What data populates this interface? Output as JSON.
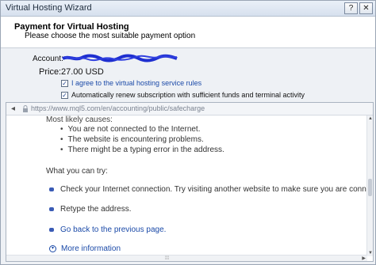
{
  "window": {
    "title": "Virtual Hosting Wizard",
    "help_label": "?",
    "close_label": "✕"
  },
  "header": {
    "title": "Payment for Virtual Hosting",
    "subtitle": "Please choose the most suitable payment option"
  },
  "form": {
    "account_label": "Account:",
    "price_label": "Price:",
    "price_value": "27.00 USD",
    "agree_label": "I agree to the virtual hosting service rules",
    "agree_checked": true,
    "renew_label": "Automatically renew subscription with sufficient funds and terminal activity",
    "renew_checked": true
  },
  "browser": {
    "url": "https://www.mql5.com/en/accounting/public/safecharge",
    "likely_causes_title": "Most likely causes:",
    "causes": [
      "You are not connected to the Internet.",
      "The website is encountering problems.",
      "There might be a typing error in the address."
    ],
    "try_title": "What you can try:",
    "try_items": [
      "Check your Internet connection. Try visiting another website to make sure you are connect",
      "Retype the address.",
      "Go back to the previous page.",
      "More information"
    ]
  },
  "colors": {
    "link": "#1b4aa8",
    "titlebar": "#d6e0ee",
    "redaction": "#1e2fd0"
  }
}
